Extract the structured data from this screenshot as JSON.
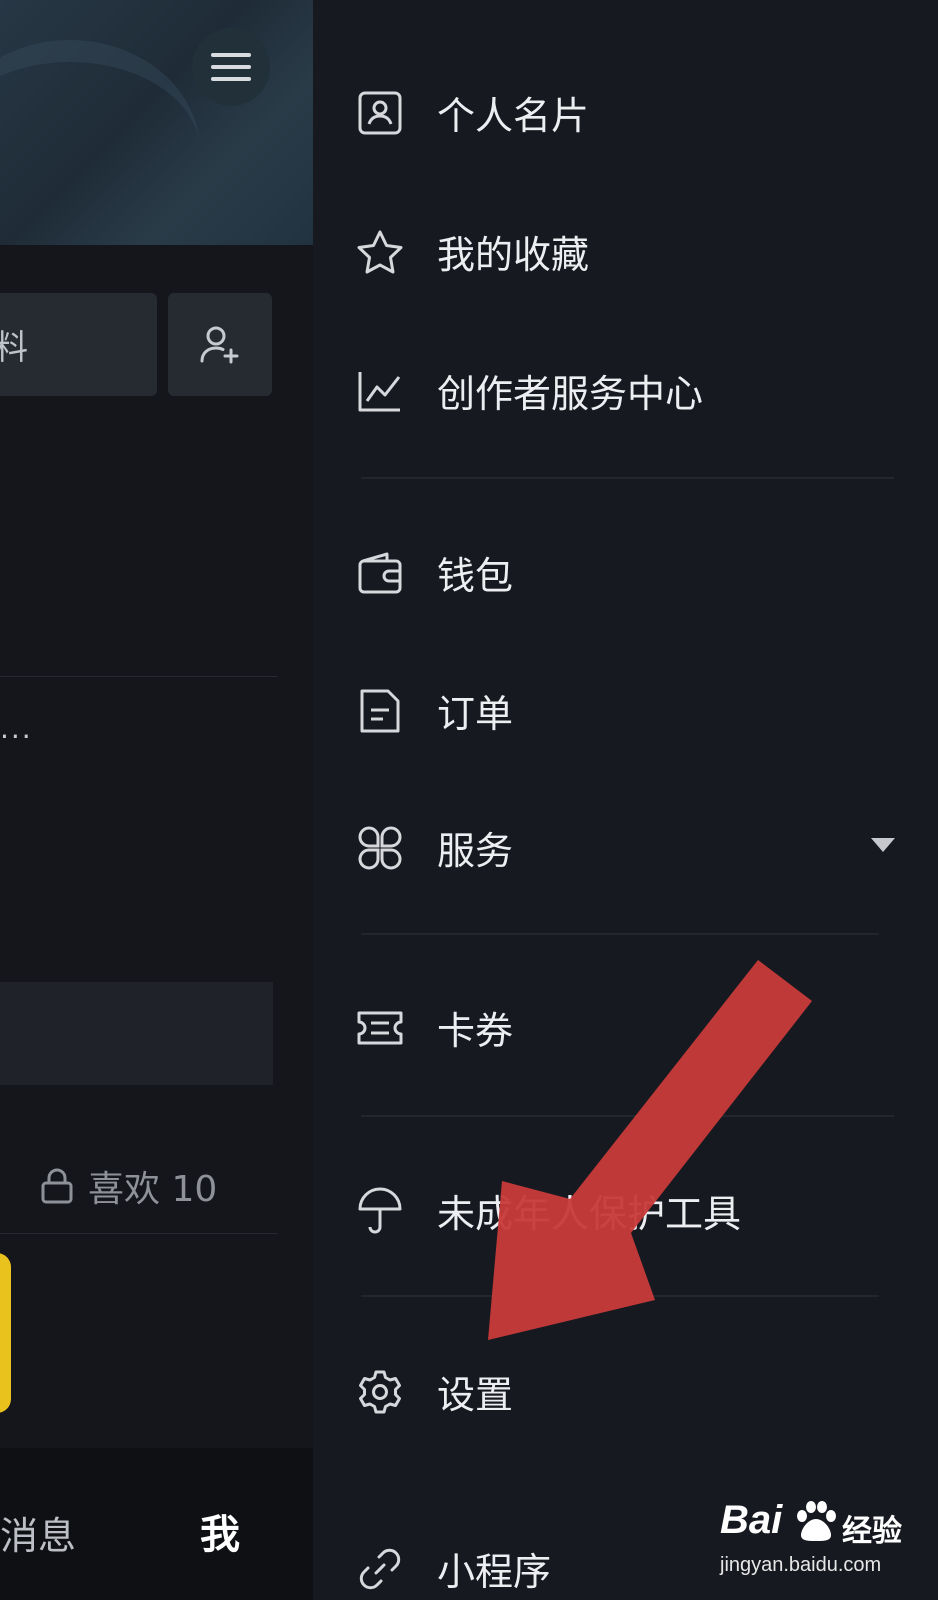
{
  "left_panel": {
    "edit_button_partial": "料",
    "ellipsis": "...",
    "likes_label": "喜欢 10",
    "nav_messages": "消息",
    "nav_me": "我"
  },
  "drawer": {
    "items": [
      {
        "label": "个人名片",
        "icon": "contact-card-icon"
      },
      {
        "label": "我的收藏",
        "icon": "star-icon"
      },
      {
        "label": "创作者服务中心",
        "icon": "line-chart-icon"
      },
      {
        "label": "钱包",
        "icon": "wallet-icon"
      },
      {
        "label": "订单",
        "icon": "document-icon"
      },
      {
        "label": "服务",
        "icon": "grid-flower-icon",
        "has_dropdown": true
      },
      {
        "label": "卡券",
        "icon": "ticket-icon"
      },
      {
        "label": "未成年人保护工具",
        "label_visible": "未成 工具",
        "icon": "umbrella-icon"
      },
      {
        "label": "设置",
        "icon": "gear-icon"
      },
      {
        "label": "小程序",
        "icon": "link-icon"
      }
    ]
  },
  "annotation": {
    "arrow_color": "#c83a3a",
    "points_to": "设置"
  },
  "watermark": {
    "brand": "Bai",
    "brand_suffix": "经验",
    "url": "jingyan.baidu.com"
  },
  "colors": {
    "background": "#171920",
    "text": "#eceef1",
    "accent_yellow": "#e9c21d"
  }
}
